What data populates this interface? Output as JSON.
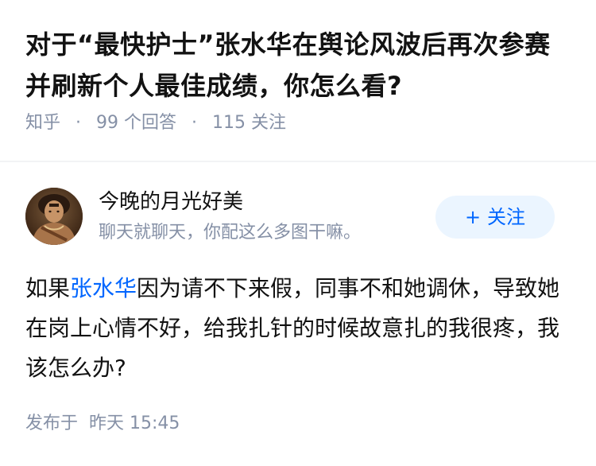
{
  "question": {
    "title": "对于“最快护士”张水华在舆论风波后再次参赛并刷新个人最佳成绩，你怎么看?",
    "source": "知乎",
    "answers_count": "99",
    "answers_label": "个回答",
    "followers_count": "115",
    "followers_label": "关注"
  },
  "author": {
    "name": "今晚的月光好美",
    "bio": "聊天就聊天，你配这么多图干嘛。",
    "avatar_icon": "avatar-photo",
    "follow_label": "关注",
    "follow_icon": "plus-icon"
  },
  "answer": {
    "text_before": "如果",
    "link_text": "张水华",
    "text_after": "因为请不下来假，同事不和她调休，导致她在岗上心情不好，给我扎针的时候故意扎的我很疼，我该怎么办?"
  },
  "footer": {
    "published_label": "发布于",
    "published_time": "昨天 15:45"
  },
  "colors": {
    "link": "#0066ff",
    "meta": "#8590a6",
    "follow_bg": "#ebf5ff"
  }
}
